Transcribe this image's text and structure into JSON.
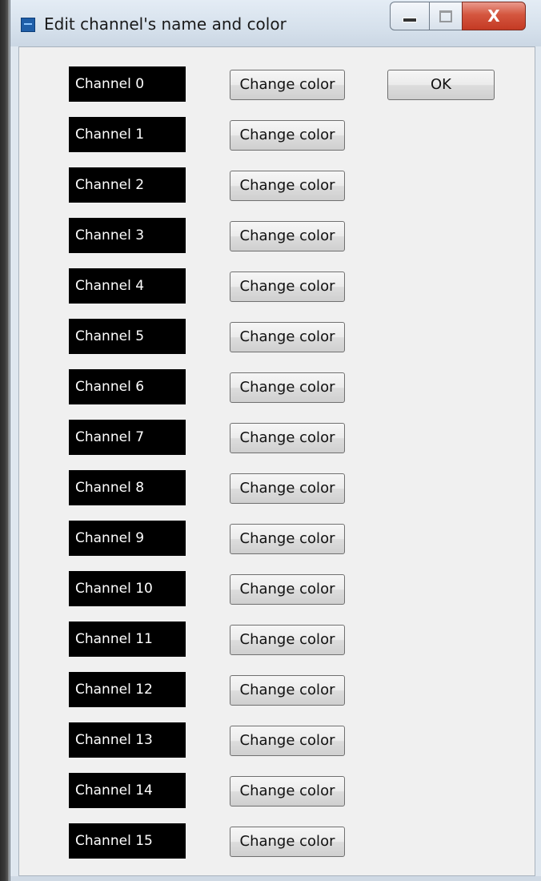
{
  "window": {
    "title": "Edit channel's name and color",
    "close_glyph": "X"
  },
  "buttons": {
    "ok_label": "OK",
    "change_color_label": "Change color"
  },
  "channels": [
    {
      "name": "Channel 0"
    },
    {
      "name": "Channel 1"
    },
    {
      "name": "Channel 2"
    },
    {
      "name": "Channel 3"
    },
    {
      "name": "Channel 4"
    },
    {
      "name": "Channel 5"
    },
    {
      "name": "Channel 6"
    },
    {
      "name": "Channel 7"
    },
    {
      "name": "Channel 8"
    },
    {
      "name": "Channel 9"
    },
    {
      "name": "Channel 10"
    },
    {
      "name": "Channel 11"
    },
    {
      "name": "Channel 12"
    },
    {
      "name": "Channel 13"
    },
    {
      "name": "Channel 14"
    },
    {
      "name": "Channel 15"
    }
  ],
  "colors": {
    "channel_background": "#000000",
    "channel_text": "#ffffff",
    "close_button": "#c43a24"
  }
}
